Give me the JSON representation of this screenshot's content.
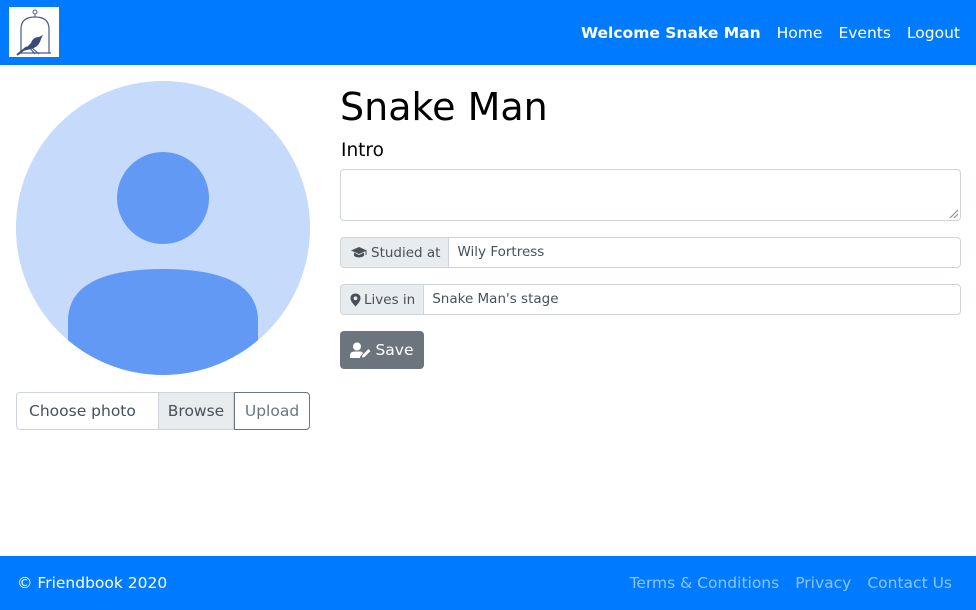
{
  "navbar": {
    "logo_icon": "bird-cage-logo",
    "welcome": "Welcome Snake Man",
    "links": [
      "Home",
      "Events",
      "Logout"
    ],
    "background": "#007bff"
  },
  "profile": {
    "name": "Snake Man",
    "avatar_icon": "user-avatar-icon",
    "intro_label": "Intro",
    "intro_value": "",
    "studied_label": "Studied at",
    "studied_icon": "graduation-cap-icon",
    "studied_value": "Wily Fortress",
    "lives_label": "Lives in",
    "lives_icon": "map-marker-icon",
    "lives_value": "Snake Man's stage",
    "save_label": "Save",
    "save_icon": "user-edit-icon"
  },
  "photo": {
    "placeholder": "Choose photo",
    "browse_label": "Browse",
    "upload_label": "Upload"
  },
  "footer": {
    "copyright": "© Friendbook 2020",
    "links": [
      "Terms & Conditions",
      "Privacy",
      "Contact Us"
    ]
  }
}
